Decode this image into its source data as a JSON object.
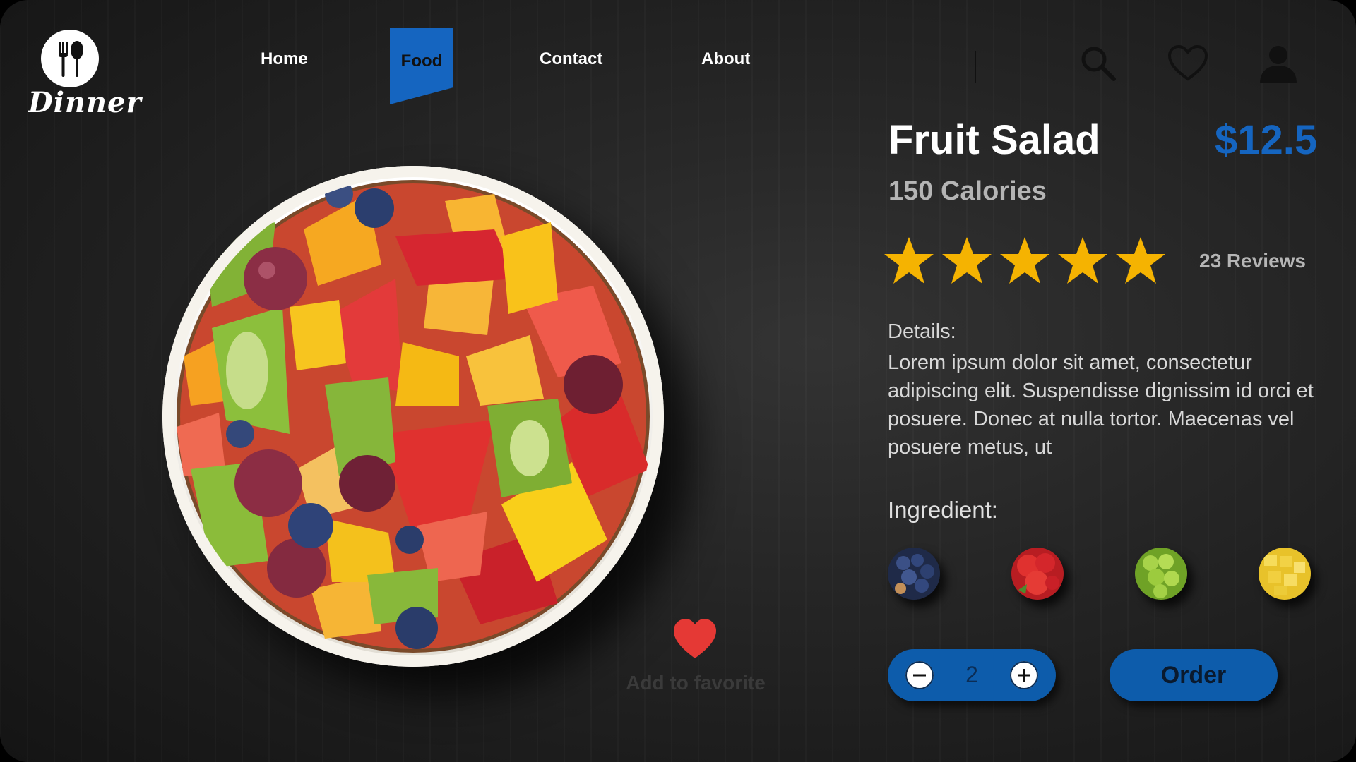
{
  "brand": {
    "name": "Dinner",
    "logo_icon": "fork-spoon-icon"
  },
  "nav": {
    "items": [
      {
        "label": "Home",
        "active": false
      },
      {
        "label": "Food",
        "active": true
      },
      {
        "label": "Contact",
        "active": false
      },
      {
        "label": "About",
        "active": false
      }
    ],
    "icons": [
      "search-icon",
      "heart-outline-icon",
      "user-icon"
    ]
  },
  "product": {
    "title": "Fruit Salad",
    "price": "$12.5",
    "calories": "150 Calories",
    "rating": 5,
    "rating_max": 5,
    "reviews": "23 Reviews",
    "details_label": "Details:",
    "details_text": "Lorem ipsum dolor sit amet, consectetur adipiscing elit. Suspendisse dignissim id orci et posuere. Donec at nulla tortor. Maecenas vel posuere metus, ut",
    "ingredient_label": "Ingredient:",
    "ingredients": [
      "blueberries",
      "strawberries",
      "grapes",
      "pineapple"
    ]
  },
  "favorite": {
    "label": "Add to favorite",
    "icon": "heart-icon"
  },
  "quantity": {
    "value": "2",
    "minus_icon": "minus-icon",
    "plus_icon": "plus-icon"
  },
  "order": {
    "label": "Order"
  },
  "colors": {
    "accent": "#1565c0",
    "button": "#0d5cab",
    "star": "#f5b301",
    "heart": "#e53935",
    "background": "#262626"
  }
}
